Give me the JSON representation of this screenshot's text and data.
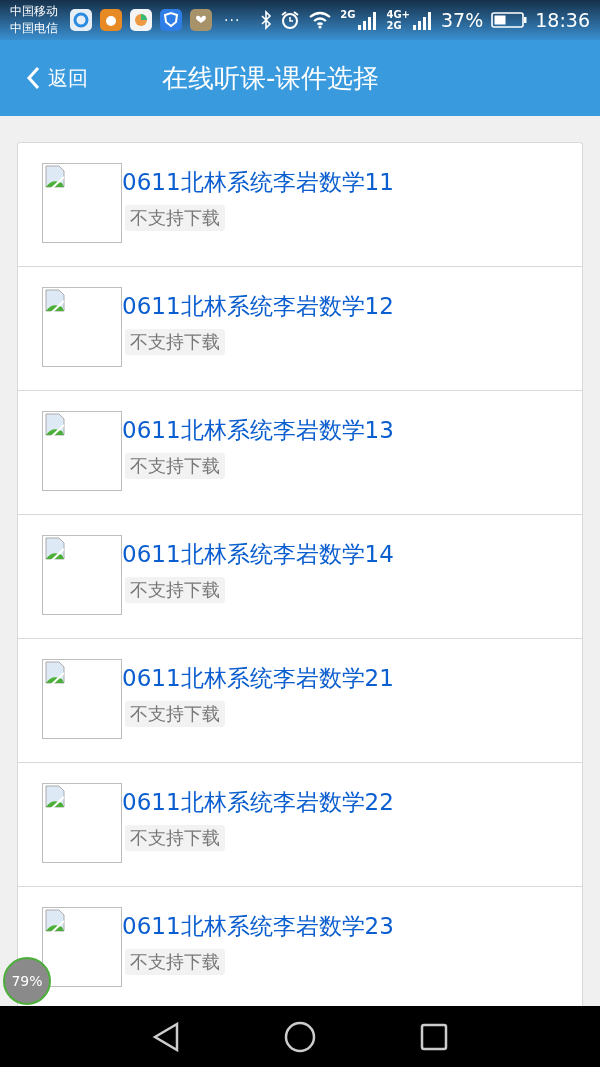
{
  "status_bar": {
    "carriers": [
      "中国移动",
      "中国电信"
    ],
    "more": "···",
    "signal_2g_label": "2G",
    "signal_4g_label": "4G+",
    "signal_4g_sub_label": "2G",
    "battery_percent": "37%",
    "time": "18:36"
  },
  "app_bar": {
    "back_label": "返回",
    "title": "在线听课-课件选择"
  },
  "items": [
    {
      "title": "0611北林系统李岩数学11",
      "tag": "不支持下载"
    },
    {
      "title": "0611北林系统李岩数学12",
      "tag": "不支持下载"
    },
    {
      "title": "0611北林系统李岩数学13",
      "tag": "不支持下载"
    },
    {
      "title": "0611北林系统李岩数学14",
      "tag": "不支持下载"
    },
    {
      "title": "0611北林系统李岩数学21",
      "tag": "不支持下载"
    },
    {
      "title": "0611北林系统李岩数学22",
      "tag": "不支持下载"
    },
    {
      "title": "0611北林系统李岩数学23",
      "tag": "不支持下载"
    }
  ],
  "floating_badge": "79%"
}
